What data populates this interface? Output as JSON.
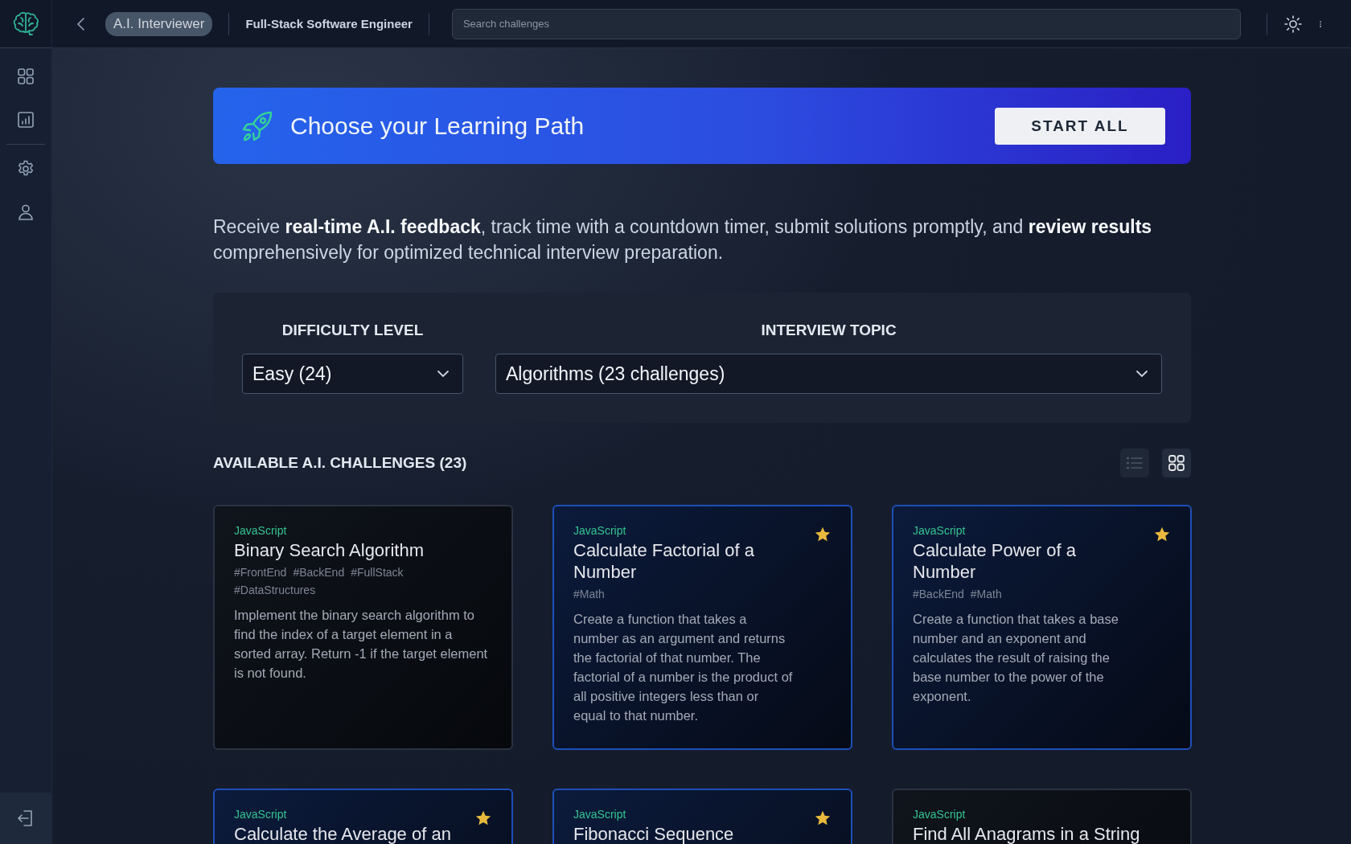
{
  "header": {
    "app_badge": "A.I. Interviewer",
    "role": "Full-Stack Software Engineer",
    "search": {
      "placeholder": "Search challenges"
    }
  },
  "sidebar": {
    "items": [
      {
        "kind": "grid"
      },
      {
        "kind": "chart"
      },
      {
        "kind": "divider"
      },
      {
        "kind": "settings"
      },
      {
        "kind": "person"
      }
    ]
  },
  "banner": {
    "title": "Choose your Learning Path",
    "button": "START ALL"
  },
  "intro": "Receive **real-time A.I. feedback**, track time with a countdown timer, submit solutions promptly, and **review results** comprehensively for optimized technical interview preparation.",
  "filters": [
    {
      "label": "DIFFICULTY LEVEL",
      "value": "Easy (24)"
    },
    {
      "label": "INTERVIEW TOPIC",
      "value": "Algorithms (23 challenges)"
    }
  ],
  "challenges_heading": "AVAILABLE A.I. CHALLENGES (23)",
  "view_toggles": [
    {
      "kind": "list",
      "selected": false
    },
    {
      "kind": "grid",
      "selected": true
    }
  ],
  "cards": [
    {
      "language": "JavaScript",
      "title": "Binary Search Algorithm",
      "tags": [
        "#FrontEnd",
        "#BackEnd",
        "#FullStack",
        "#DataStructures"
      ],
      "description": "Implement the binary search algorithm to find the index of a target element in a sorted array. Return -1 if the target element is not found.",
      "starred": false
    },
    {
      "language": "JavaScript",
      "title": "Calculate Factorial of a Number",
      "tags": [
        "#Math"
      ],
      "description": "Create a function that takes a number as an argument and returns the factorial of that number. The factorial of a number is the product of all positive integers less than or equal to that number.",
      "starred": true
    },
    {
      "language": "JavaScript",
      "title": "Calculate Power of a Number",
      "tags": [
        "#BackEnd",
        "#Math"
      ],
      "description": "Create a function that takes a base number and an exponent and calculates the result of raising the base number to the power of the exponent.",
      "starred": true
    },
    {
      "language": "JavaScript",
      "title": "Calculate the Average of an",
      "starred": true
    },
    {
      "language": "JavaScript",
      "title": "Fibonacci Sequence",
      "starred": true
    },
    {
      "language": "JavaScript",
      "title": "Find All Anagrams in a String",
      "starred": false
    }
  ]
}
